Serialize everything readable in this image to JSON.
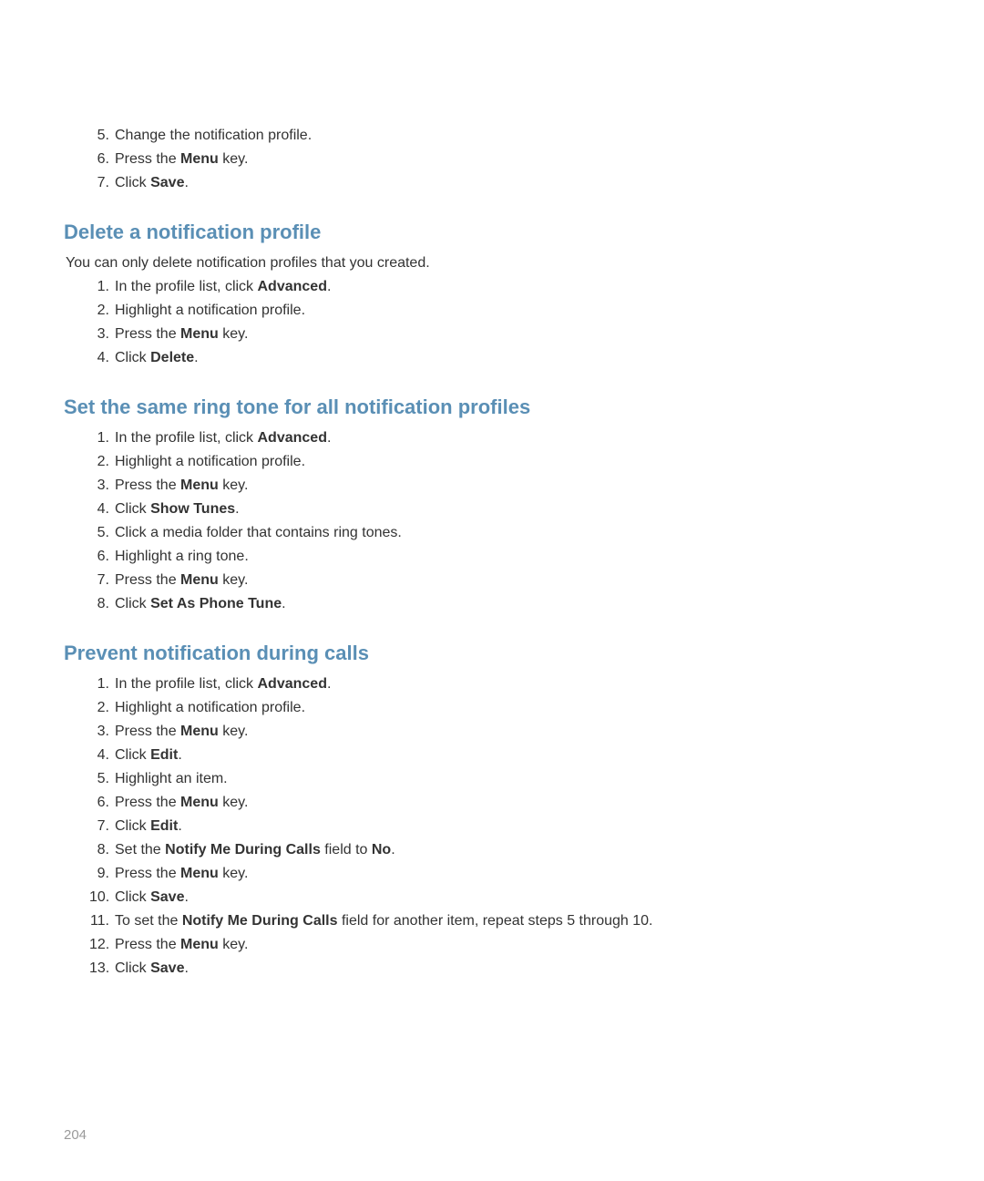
{
  "section0": {
    "items": [
      {
        "pre": "Change the notification profile."
      },
      {
        "pre": "Press the ",
        "bold": "Menu",
        "post": " key."
      },
      {
        "pre": "Click ",
        "bold": "Save",
        "post": "."
      }
    ]
  },
  "section1": {
    "heading": "Delete a notification profile",
    "intro": "You can only delete notification profiles that you created.",
    "items": [
      {
        "pre": "In the profile list, click ",
        "bold": "Advanced",
        "post": "."
      },
      {
        "pre": "Highlight a notification profile."
      },
      {
        "pre": "Press the ",
        "bold": "Menu",
        "post": " key."
      },
      {
        "pre": "Click ",
        "bold": "Delete",
        "post": "."
      }
    ]
  },
  "section2": {
    "heading": "Set the same ring tone for all notification profiles",
    "items": [
      {
        "pre": "In the profile list, click ",
        "bold": "Advanced",
        "post": "."
      },
      {
        "pre": "Highlight a notification profile."
      },
      {
        "pre": "Press the ",
        "bold": "Menu",
        "post": " key."
      },
      {
        "pre": "Click ",
        "bold": "Show Tunes",
        "post": "."
      },
      {
        "pre": "Click a media folder that contains ring tones."
      },
      {
        "pre": "Highlight a ring tone."
      },
      {
        "pre": "Press the ",
        "bold": "Menu",
        "post": " key."
      },
      {
        "pre": "Click ",
        "bold": "Set As Phone Tune",
        "post": "."
      }
    ]
  },
  "section3": {
    "heading": "Prevent notification during calls",
    "items": [
      {
        "pre": "In the profile list, click ",
        "bold": "Advanced",
        "post": "."
      },
      {
        "pre": "Highlight a notification profile."
      },
      {
        "pre": "Press the ",
        "bold": "Menu",
        "post": " key."
      },
      {
        "pre": "Click ",
        "bold": "Edit",
        "post": "."
      },
      {
        "pre": "Highlight an item."
      },
      {
        "pre": "Press the ",
        "bold": "Menu",
        "post": " key."
      },
      {
        "pre": "Click ",
        "bold": "Edit",
        "post": "."
      },
      {
        "pre": "Set the ",
        "bold": "Notify Me During Calls",
        "post": " field to ",
        "bold2": "No",
        "post2": "."
      },
      {
        "pre": "Press the ",
        "bold": "Menu",
        "post": " key."
      },
      {
        "pre": "Click ",
        "bold": "Save",
        "post": "."
      },
      {
        "pre": "To set the ",
        "bold": "Notify Me During Calls",
        "post": " field for another item, repeat steps 5 through 10."
      },
      {
        "pre": "Press the ",
        "bold": "Menu",
        "post": " key."
      },
      {
        "pre": "Click ",
        "bold": "Save",
        "post": "."
      }
    ]
  },
  "pageNumber": "204"
}
